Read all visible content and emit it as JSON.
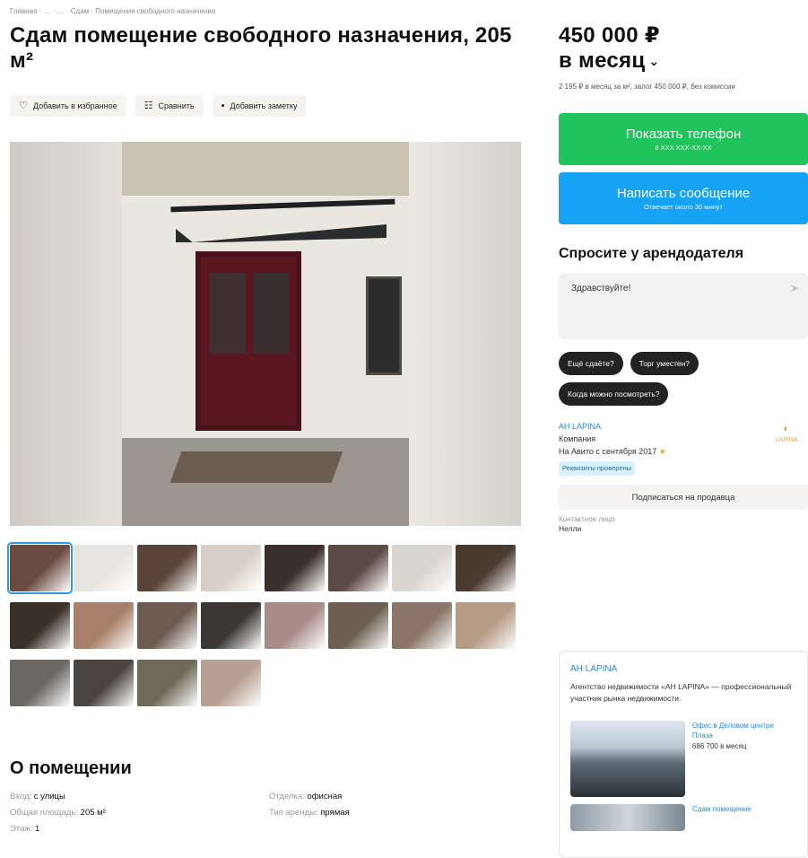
{
  "breadcrumb": "Главная · … · … · Сдам · Помещения свободного назначения",
  "title": "Сдам помещение свободного назначения, 205 м²",
  "actions": {
    "favorite_label": "Добавить в избранное",
    "compare_label": "Сравнить",
    "note_label": "Добавить заметку"
  },
  "price": {
    "amount": "450 000 ₽",
    "period": "в месяц",
    "note": "2 195 ₽ в месяц за м², залог 450 000 ₽, без комиссии"
  },
  "buttons": {
    "phone_label": "Показать телефон",
    "phone_sub": "8 XXX XXX-XX-XX",
    "message_label": "Написать сообщение",
    "message_sub": "Отвечает около 30 минут"
  },
  "ask": {
    "title": "Спросите у арендодателя",
    "message": "Здравствуйте!",
    "chips": [
      "Ещё сдаёте?",
      "Торг уместен?",
      "Когда можно посмотреть?"
    ]
  },
  "seller": {
    "name": "АН LAPINA",
    "type": "Компания",
    "since": "На Авито с сентября 2017",
    "verified": "Реквизиты проверены",
    "logo_text": "LAPINA",
    "subscribe_label": "Подписаться на продавца",
    "contact_label": "Контактное лицо",
    "contact_name": "Нелли"
  },
  "card": {
    "title": "АН LAPINA",
    "description": "Агентство недвижимости «АН LAPINA» — профессиональный участник рынка недвижимости.",
    "listing_title": "Офис в Деловом центре Плаза",
    "listing_price": "686 700 в месяц",
    "listing2_title": "Сдам помещение"
  },
  "about": {
    "title": "О помещении",
    "params": [
      {
        "key": "Вход: ",
        "value": "с улицы"
      },
      {
        "key": "Отделка: ",
        "value": "офисная"
      },
      {
        "key": "Общая площадь: ",
        "value": "205 м²"
      },
      {
        "key": "Тип аренды: ",
        "value": "прямая"
      },
      {
        "key": "Этаж: ",
        "value": "1"
      }
    ]
  },
  "thumb_colors": [
    [
      "#6a4b42",
      "#e6e4e0",
      "#5a4338",
      "#d7cfc5",
      "#3b2f2d",
      "#5c4a44",
      "#d9d5d0",
      "#4a3a30"
    ],
    [
      "#3b3027",
      "#a87f6a",
      "#6d5b50",
      "#3a3633",
      "#a88a86",
      "#6c5e50",
      "#8a7566",
      "#b59a84"
    ],
    [
      "#6b6864",
      "#4a4540",
      "#6d6a58",
      "#b8a093"
    ]
  ],
  "colors": {
    "phone_button": "#1fc45a",
    "message_button": "#16a3f5",
    "link": "#1b8ee6"
  }
}
